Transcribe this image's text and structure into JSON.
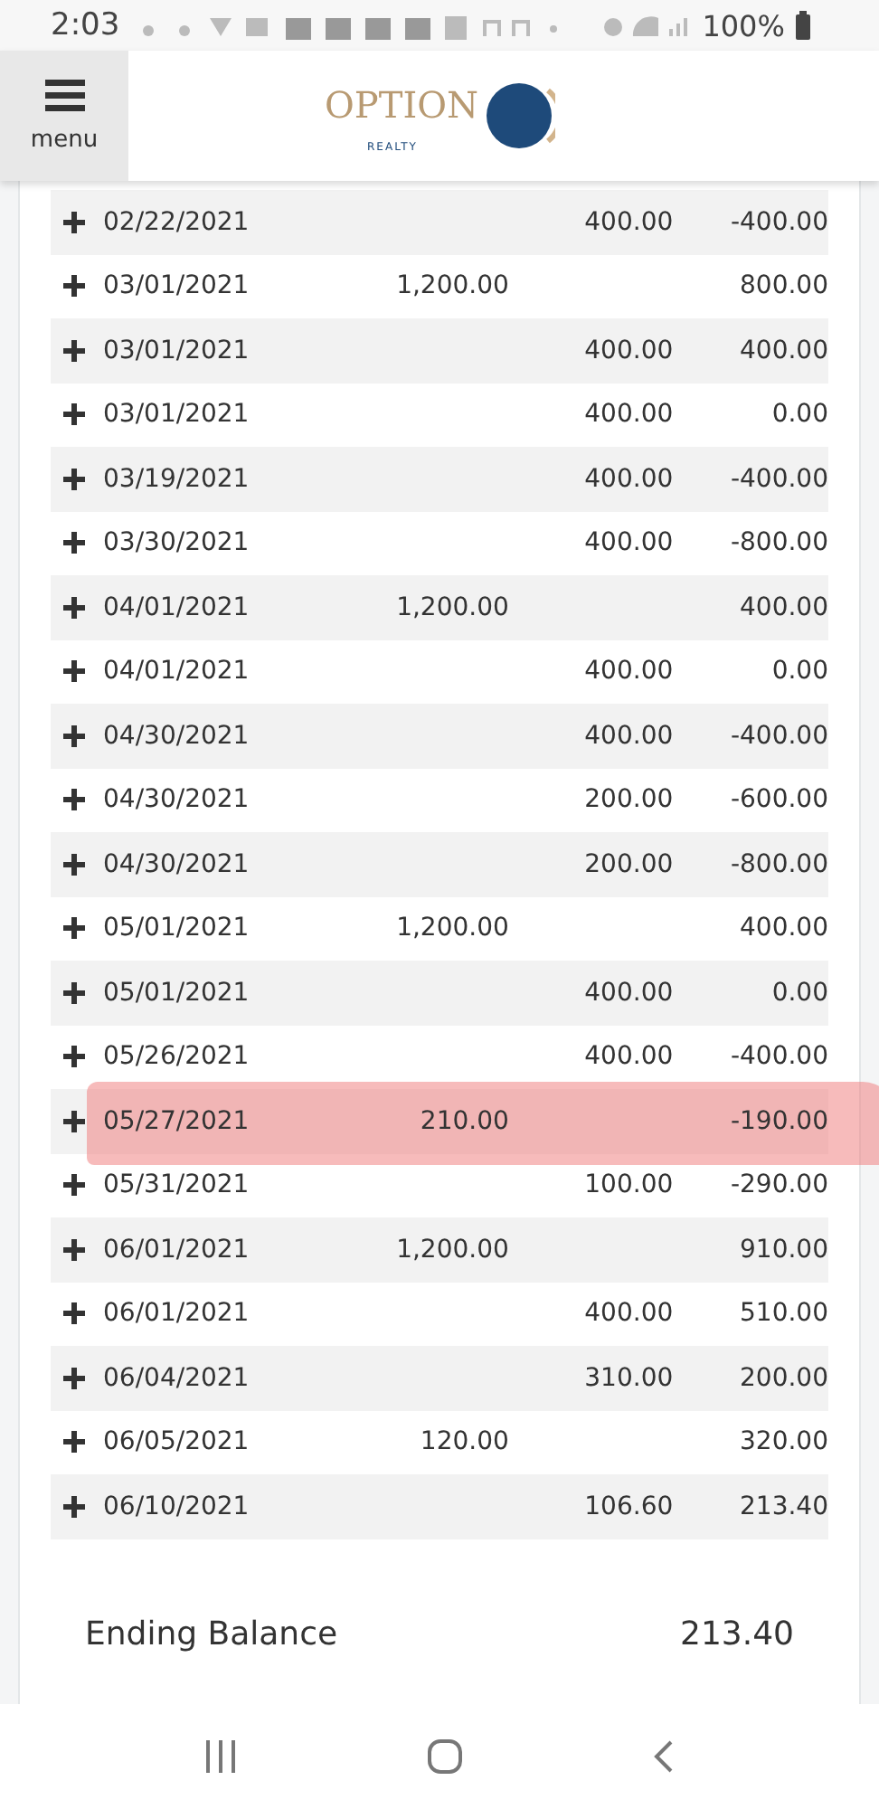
{
  "status_bar": {
    "time": "2:03",
    "battery": "100%"
  },
  "header": {
    "menu_label": "menu",
    "logo": {
      "name": "OPTION",
      "tagline": "REALTY"
    }
  },
  "ledger": {
    "rows": [
      {
        "date": "02/22/2021",
        "credit": "",
        "debit": "400.00",
        "balance": "-400.00",
        "highlighted": false
      },
      {
        "date": "03/01/2021",
        "credit": "1,200.00",
        "debit": "",
        "balance": "800.00",
        "highlighted": false
      },
      {
        "date": "03/01/2021",
        "credit": "",
        "debit": "400.00",
        "balance": "400.00",
        "highlighted": false
      },
      {
        "date": "03/01/2021",
        "credit": "",
        "debit": "400.00",
        "balance": "0.00",
        "highlighted": false
      },
      {
        "date": "03/19/2021",
        "credit": "",
        "debit": "400.00",
        "balance": "-400.00",
        "highlighted": false
      },
      {
        "date": "03/30/2021",
        "credit": "",
        "debit": "400.00",
        "balance": "-800.00",
        "highlighted": false
      },
      {
        "date": "04/01/2021",
        "credit": "1,200.00",
        "debit": "",
        "balance": "400.00",
        "highlighted": false
      },
      {
        "date": "04/01/2021",
        "credit": "",
        "debit": "400.00",
        "balance": "0.00",
        "highlighted": false
      },
      {
        "date": "04/30/2021",
        "credit": "",
        "debit": "400.00",
        "balance": "-400.00",
        "highlighted": false
      },
      {
        "date": "04/30/2021",
        "credit": "",
        "debit": "200.00",
        "balance": "-600.00",
        "highlighted": false
      },
      {
        "date": "04/30/2021",
        "credit": "",
        "debit": "200.00",
        "balance": "-800.00",
        "highlighted": false
      },
      {
        "date": "05/01/2021",
        "credit": "1,200.00",
        "debit": "",
        "balance": "400.00",
        "highlighted": false
      },
      {
        "date": "05/01/2021",
        "credit": "",
        "debit": "400.00",
        "balance": "0.00",
        "highlighted": false
      },
      {
        "date": "05/26/2021",
        "credit": "",
        "debit": "400.00",
        "balance": "-400.00",
        "highlighted": false
      },
      {
        "date": "05/27/2021",
        "credit": "210.00",
        "debit": "",
        "balance": "-190.00",
        "highlighted": true
      },
      {
        "date": "05/31/2021",
        "credit": "",
        "debit": "100.00",
        "balance": "-290.00",
        "highlighted": false
      },
      {
        "date": "06/01/2021",
        "credit": "1,200.00",
        "debit": "",
        "balance": "910.00",
        "highlighted": false
      },
      {
        "date": "06/01/2021",
        "credit": "",
        "debit": "400.00",
        "balance": "510.00",
        "highlighted": false
      },
      {
        "date": "06/04/2021",
        "credit": "",
        "debit": "310.00",
        "balance": "200.00",
        "highlighted": false
      },
      {
        "date": "06/05/2021",
        "credit": "120.00",
        "debit": "",
        "balance": "320.00",
        "highlighted": false
      },
      {
        "date": "06/10/2021",
        "credit": "",
        "debit": "106.60",
        "balance": "213.40",
        "highlighted": false
      }
    ],
    "ending_label": "Ending Balance",
    "ending_value": "213.40"
  }
}
